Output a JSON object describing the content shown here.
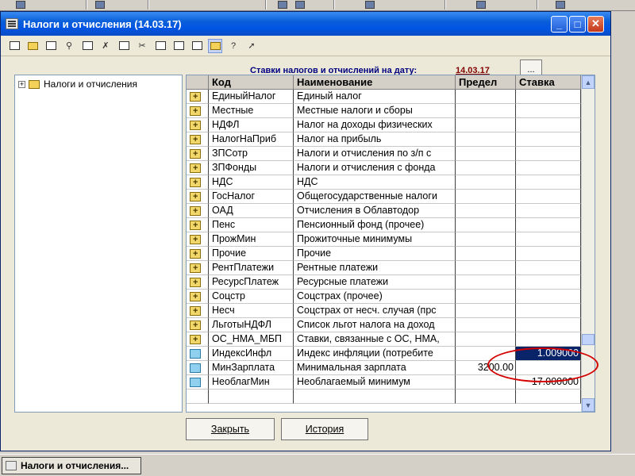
{
  "window": {
    "title": "Налоги и отчисления (14.03.17)",
    "minimize": "_",
    "maximize": "□",
    "close": "✕"
  },
  "toolbar": {
    "icons": [
      "new-icon",
      "open-folder-icon",
      "edit-icon",
      "find-icon",
      "copy-row-icon",
      "delete-icon",
      "properties-icon",
      "cut-icon",
      "copy-icon",
      "paste-icon",
      "print-icon",
      "hierarchy-icon",
      "help-icon",
      "context-help-icon"
    ]
  },
  "rates": {
    "label": "Ставки налогов и отчислений на дату:",
    "date": "14.03.17",
    "select_button": "..."
  },
  "tree": {
    "root_label": "Налоги и отчисления",
    "expand": "+"
  },
  "grid": {
    "columns": {
      "code": "Код",
      "name": "Наименование",
      "limit": "Предел",
      "rate": "Ставка"
    },
    "rows": [
      {
        "code": "ЕдиныйНалог",
        "name": "Единый налог",
        "limit": "",
        "rate": ""
      },
      {
        "code": "Местные",
        "name": "Местные налоги и сборы",
        "limit": "",
        "rate": ""
      },
      {
        "code": "НДФЛ",
        "name": "Налог на доходы физических",
        "limit": "",
        "rate": ""
      },
      {
        "code": "НалогНаПриб",
        "name": "Налог на прибыль",
        "limit": "",
        "rate": ""
      },
      {
        "code": "ЗПСотр",
        "name": "Налоги и отчисления по з/п с",
        "limit": "",
        "rate": ""
      },
      {
        "code": "ЗПФонды",
        "name": "Налоги и отчисления с фонда",
        "limit": "",
        "rate": ""
      },
      {
        "code": "НДС",
        "name": "НДС",
        "limit": "",
        "rate": ""
      },
      {
        "code": "ГосНалог",
        "name": "Общегосударственные налоги",
        "limit": "",
        "rate": ""
      },
      {
        "code": "ОАД",
        "name": "Отчисления в Облавтодор",
        "limit": "",
        "rate": ""
      },
      {
        "code": "Пенс",
        "name": "Пенсионный фонд (прочее)",
        "limit": "",
        "rate": ""
      },
      {
        "code": "ПрожМин",
        "name": "Прожиточные минимумы",
        "limit": "",
        "rate": ""
      },
      {
        "code": "Прочие",
        "name": "Прочие",
        "limit": "",
        "rate": ""
      },
      {
        "code": "РентПлатежи",
        "name": "Рентные платежи",
        "limit": "",
        "rate": ""
      },
      {
        "code": "РесурсПлатеж",
        "name": "Ресурсные платежи",
        "limit": "",
        "rate": ""
      },
      {
        "code": "Соцстр",
        "name": "Соцстрах (прочее)",
        "limit": "",
        "rate": ""
      },
      {
        "code": "Несч",
        "name": "Соцстрах от несч. случая (прс",
        "limit": "",
        "rate": ""
      },
      {
        "code": "ЛьготыНДФЛ",
        "name": "Список льгот налога на доход",
        "limit": "",
        "rate": ""
      },
      {
        "code": "ОС_НМА_МБП",
        "name": "Ставки, связанные с ОС, НМА,",
        "limit": "",
        "rate": ""
      },
      {
        "code": "ИндексИнфл",
        "name": "Индекс инфляции (потребите",
        "limit": "",
        "rate": "1.009000"
      },
      {
        "code": "МинЗарплата",
        "name": "Минимальная зарплата",
        "limit": "3200.00",
        "rate": ""
      },
      {
        "code": "НеоблагМин",
        "name": "Необлагаемый минимум",
        "limit": "",
        "rate": "17.000000"
      }
    ]
  },
  "buttons": {
    "close": "Закрыть",
    "history": "История"
  },
  "taskbar": {
    "item": "Налоги и отчисления..."
  }
}
